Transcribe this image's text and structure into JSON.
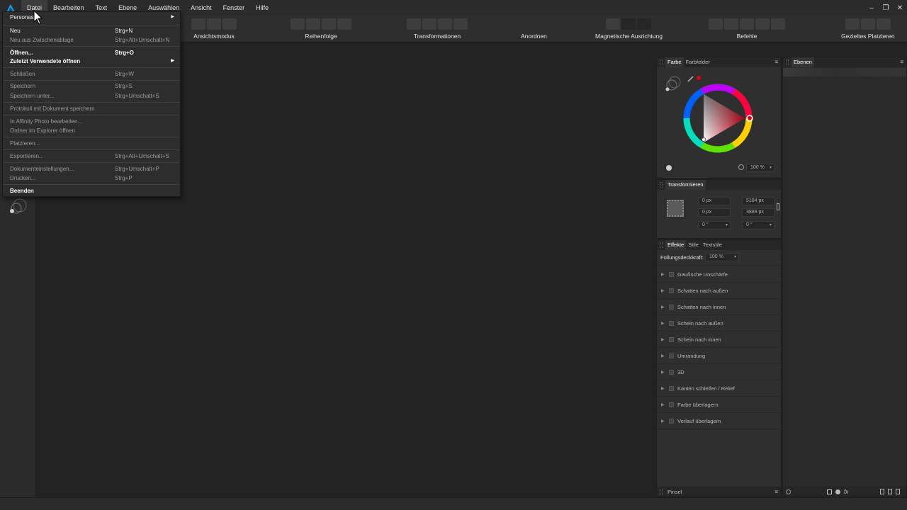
{
  "menubar": {
    "items": [
      "Datei",
      "Bearbeiten",
      "Text",
      "Ebene",
      "Auswählen",
      "Ansicht",
      "Fenster",
      "Hilfe"
    ]
  },
  "window_controls": {
    "minimize": "–",
    "restore": "❐",
    "close": "✕"
  },
  "toolbar": {
    "groups": [
      {
        "label": "Ansichtsmodus"
      },
      {
        "label": "Reihenfolge"
      },
      {
        "label": "Transformationen"
      },
      {
        "label": "Anordnen"
      },
      {
        "label": "Magnetische Ausrichtung"
      },
      {
        "label": "Befehle"
      },
      {
        "label": "Gezieltes Platzieren"
      }
    ]
  },
  "file_menu": {
    "items": [
      {
        "label": "Personas",
        "shortcut": "",
        "submenu": true,
        "enabled": true,
        "bold": false
      },
      {
        "label": "Neu",
        "shortcut": "Strg+N",
        "submenu": false,
        "enabled": true,
        "bold": false
      },
      {
        "label": "Neu aus Zwischenablage",
        "shortcut": "Strg+Alt+Umschalt+N",
        "submenu": false,
        "enabled": false,
        "bold": false
      },
      {
        "label": "Öffnen...",
        "shortcut": "Strg+O",
        "submenu": false,
        "enabled": true,
        "bold": true
      },
      {
        "label": "Zuletzt Verwendete öffnen",
        "shortcut": "",
        "submenu": true,
        "enabled": true,
        "bold": true
      },
      {
        "label": "Schließen",
        "shortcut": "Strg+W",
        "submenu": false,
        "enabled": false,
        "bold": false
      },
      {
        "label": "Speichern",
        "shortcut": "Strg+S",
        "submenu": false,
        "enabled": false,
        "bold": false
      },
      {
        "label": "Speichern unter...",
        "shortcut": "Strg+Umschalt+S",
        "submenu": false,
        "enabled": false,
        "bold": false
      },
      {
        "label": "Protokoll mit Dokument speichern",
        "shortcut": "",
        "submenu": false,
        "enabled": false,
        "bold": false
      },
      {
        "label": "In Affinity Photo bearbeiten...",
        "shortcut": "",
        "submenu": false,
        "enabled": false,
        "bold": false
      },
      {
        "label": "Ordner im Explorer öffnen",
        "shortcut": "",
        "submenu": false,
        "enabled": false,
        "bold": false
      },
      {
        "label": "Platzieren...",
        "shortcut": "",
        "submenu": false,
        "enabled": false,
        "bold": false
      },
      {
        "label": "Exportieren...",
        "shortcut": "Strg+Alt+Umschalt+S",
        "submenu": false,
        "enabled": false,
        "bold": false
      },
      {
        "label": "Dokumenteinstellungen...",
        "shortcut": "Strg+Umschalt+P",
        "submenu": false,
        "enabled": false,
        "bold": false
      },
      {
        "label": "Drucken...",
        "shortcut": "Strg+P",
        "submenu": false,
        "enabled": false,
        "bold": false
      },
      {
        "label": "Beenden",
        "shortcut": "",
        "submenu": false,
        "enabled": true,
        "bold": true
      }
    ]
  },
  "color_panel": {
    "tabs": [
      "Farbe",
      "Farbfelder"
    ],
    "opacity": "100 %",
    "accent": "#e0001a"
  },
  "transform_panel": {
    "title": "Transformieren",
    "x": "0 px",
    "y": "0 px",
    "width": "5184 px",
    "height": "3888 px",
    "rotation": "0 °",
    "shear": "0 °"
  },
  "effects_panel": {
    "tabs": [
      "Effekte",
      "Stile",
      "Textstile"
    ],
    "fill_opacity_label": "Füllungsdeckkraft:",
    "fill_opacity_value": "100 %",
    "effects": [
      "Gaußsche Unschärfe",
      "Schatten nach außen",
      "Schatten nach innen",
      "Schein nach außen",
      "Schein nach innen",
      "Umrandung",
      "3D",
      "Kanten schleifen / Relief",
      "Farbe überlagern",
      "Verlauf überlagern"
    ]
  },
  "brush_panel": {
    "title": "Pinsel"
  },
  "layers_panel": {
    "title": "Ebenen"
  }
}
